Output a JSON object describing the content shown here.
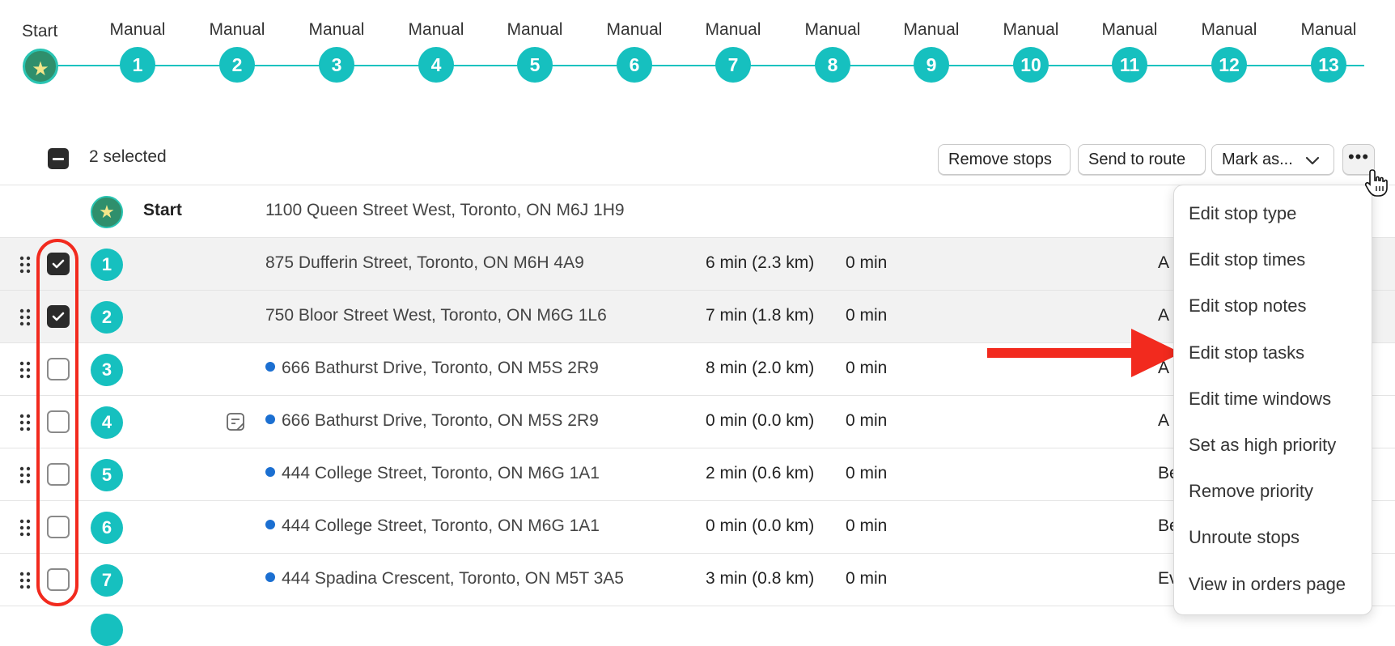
{
  "timeline": {
    "start_label": "Start",
    "routes": [
      {
        "label": "Manual",
        "num": "1"
      },
      {
        "label": "Manual",
        "num": "2"
      },
      {
        "label": "Manual",
        "num": "3"
      },
      {
        "label": "Manual",
        "num": "4"
      },
      {
        "label": "Manual",
        "num": "5"
      },
      {
        "label": "Manual",
        "num": "6"
      },
      {
        "label": "Manual",
        "num": "7"
      },
      {
        "label": "Manual",
        "num": "8"
      },
      {
        "label": "Manual",
        "num": "9"
      },
      {
        "label": "Manual",
        "num": "10"
      },
      {
        "label": "Manual",
        "num": "11"
      },
      {
        "label": "Manual",
        "num": "12"
      },
      {
        "label": "Manual",
        "num": "13"
      }
    ],
    "accent_color": "#16c0bf",
    "start_color": "#2f8f6c"
  },
  "toolbar": {
    "selected_text": "2 selected",
    "remove_stops": "Remove stops",
    "send_to_route": "Send to route",
    "mark_as": "Mark as...",
    "more": "•••"
  },
  "start_row": {
    "label": "Start",
    "address": "1100 Queen Street West, Toronto, ON M6J 1H9"
  },
  "stops": [
    {
      "num": "1",
      "address": "875 Dufferin Street, Toronto, ON M6H 4A9",
      "travel": "6 min (2.3 km)",
      "dwell": "0 min",
      "col": "A",
      "checked": true
    },
    {
      "num": "2",
      "address": "750 Bloor Street West, Toronto, ON M6G 1L6",
      "travel": "7 min (1.8 km)",
      "dwell": "0 min",
      "col": "A",
      "checked": true
    },
    {
      "num": "3",
      "address": "666 Bathurst Drive, Toronto, ON M5S 2R9",
      "travel": "8 min (2.0 km)",
      "dwell": "0 min",
      "col": "A",
      "checked": false
    },
    {
      "num": "4",
      "address": "666 Bathurst Drive, Toronto, ON M5S 2R9",
      "travel": "0 min (0.0 km)",
      "dwell": "0 min",
      "col": "A",
      "checked": false
    },
    {
      "num": "5",
      "address": "444 College Street, Toronto, ON M6G 1A1",
      "travel": "2 min (0.6 km)",
      "dwell": "0 min",
      "col": "Be",
      "checked": false
    },
    {
      "num": "6",
      "address": "444 College Street, Toronto, ON M6G 1A1",
      "travel": "0 min (0.0 km)",
      "dwell": "0 min",
      "col": "Be",
      "checked": false
    },
    {
      "num": "7",
      "address": "444 Spadina Crescent, Toronto, ON M5T 3A5",
      "travel": "3 min (0.8 km)",
      "dwell": "0 min",
      "col": "Ev",
      "checked": false
    }
  ],
  "menu": {
    "items": [
      "Edit stop type",
      "Edit stop times",
      "Edit stop notes",
      "Edit stop tasks",
      "Edit time windows",
      "Set as high priority",
      "Remove priority",
      "Unroute stops",
      "View in orders page"
    ]
  },
  "annotation_color": "#f22a1e"
}
